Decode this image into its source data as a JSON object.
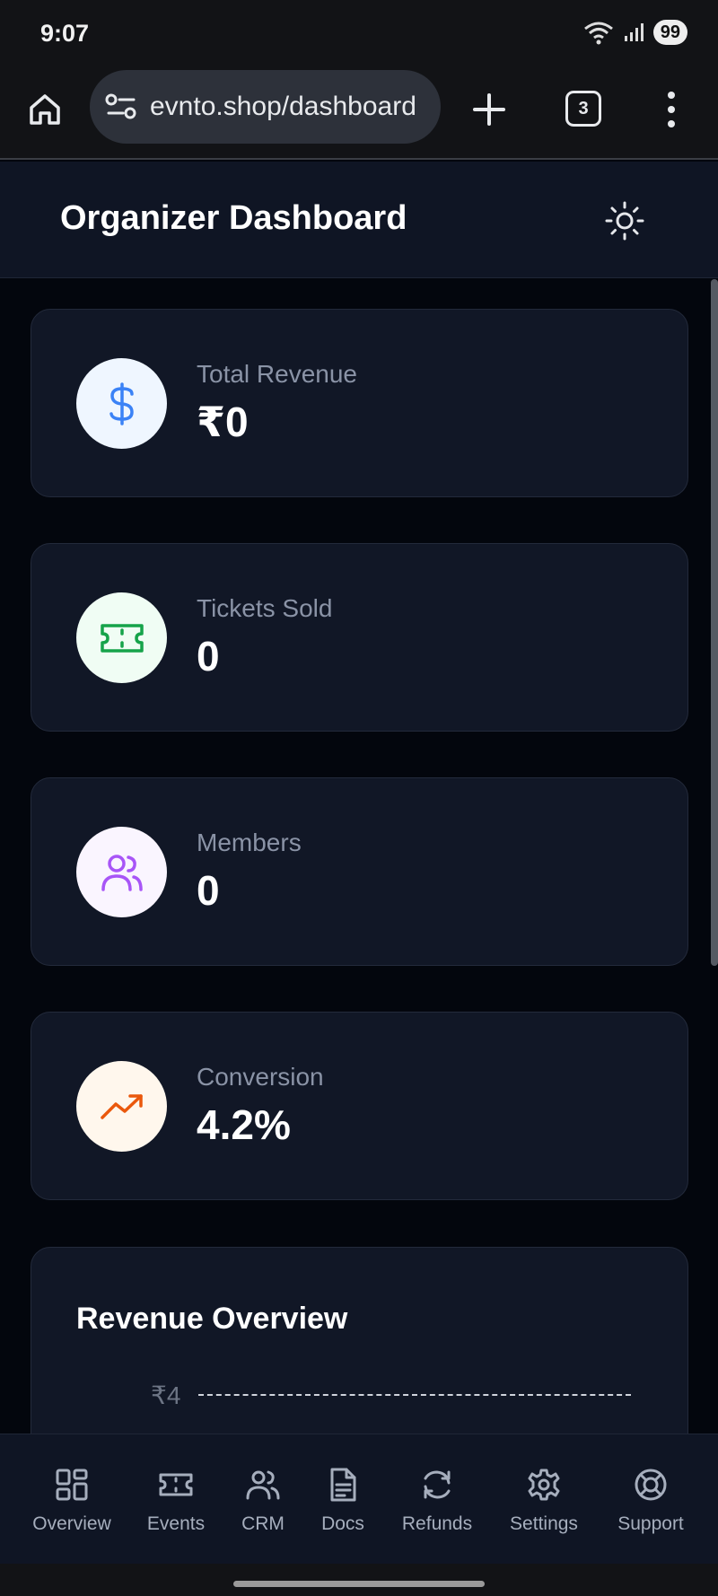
{
  "status_bar": {
    "time": "9:07",
    "battery": "99"
  },
  "browser": {
    "url": "evnto.shop/dashboard",
    "tab_count": "3"
  },
  "header": {
    "title": "Organizer Dashboard"
  },
  "stats": [
    {
      "label": "Total Revenue",
      "value": "₹0",
      "icon": "dollar-icon",
      "icon_bg": "#eff6ff",
      "icon_color": "#3b82f6"
    },
    {
      "label": "Tickets Sold",
      "value": "0",
      "icon": "ticket-icon",
      "icon_bg": "#f0fdf4",
      "icon_color": "#16a34a"
    },
    {
      "label": "Members",
      "value": "0",
      "icon": "users-icon",
      "icon_bg": "#faf5ff",
      "icon_color": "#a855f7"
    },
    {
      "label": "Conversion",
      "value": "4.2%",
      "icon": "trending-up-icon",
      "icon_bg": "#fff7ed",
      "icon_color": "#ea580c"
    }
  ],
  "revenue_chart": {
    "title": "Revenue Overview",
    "top_tick": "₹4"
  },
  "bottom_nav": [
    {
      "label": "Overview",
      "icon": "grid-icon"
    },
    {
      "label": "Events",
      "icon": "ticket-icon"
    },
    {
      "label": "CRM",
      "icon": "users-icon"
    },
    {
      "label": "Docs",
      "icon": "document-icon"
    },
    {
      "label": "Refunds",
      "icon": "refresh-icon"
    },
    {
      "label": "Settings",
      "icon": "gear-icon"
    },
    {
      "label": "Support",
      "icon": "lifebuoy-icon"
    }
  ]
}
